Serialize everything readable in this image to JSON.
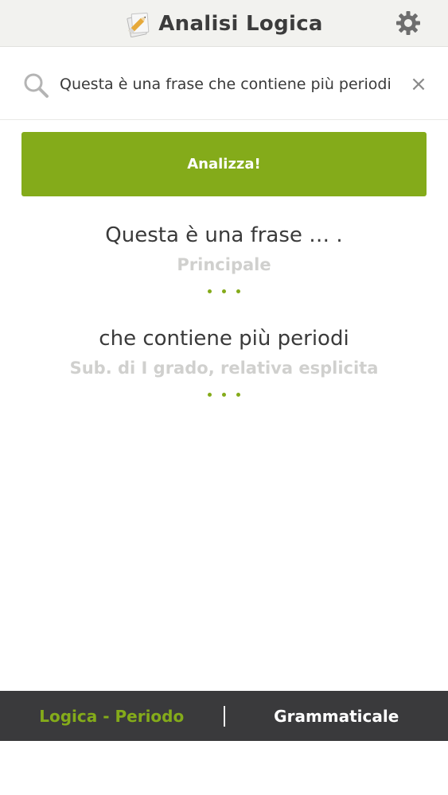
{
  "header": {
    "title": "Analisi Logica",
    "logo_icon": "pencil-paper-icon",
    "settings_icon": "gear-icon"
  },
  "search": {
    "value": "Questa è una frase che contiene più periodi",
    "search_icon": "search-icon",
    "clear_icon": "close-icon",
    "clear_glyph": "×"
  },
  "analyze_button": {
    "label": "Analizza!"
  },
  "results": [
    {
      "text": "Questa è una frase … .",
      "type": "Principale"
    },
    {
      "text": "che contiene più periodi",
      "type": "Sub. di I grado, relativa esplicita"
    }
  ],
  "bottom_nav": {
    "tabs": [
      {
        "label": "Logica - Periodo",
        "active": true
      },
      {
        "label": "Grammaticale",
        "active": false
      }
    ]
  },
  "colors": {
    "accent": "#84ab1a",
    "header_bg": "#f2f2ef",
    "nav_bg": "#3a3a3c",
    "muted_text": "#d0d0ce"
  }
}
